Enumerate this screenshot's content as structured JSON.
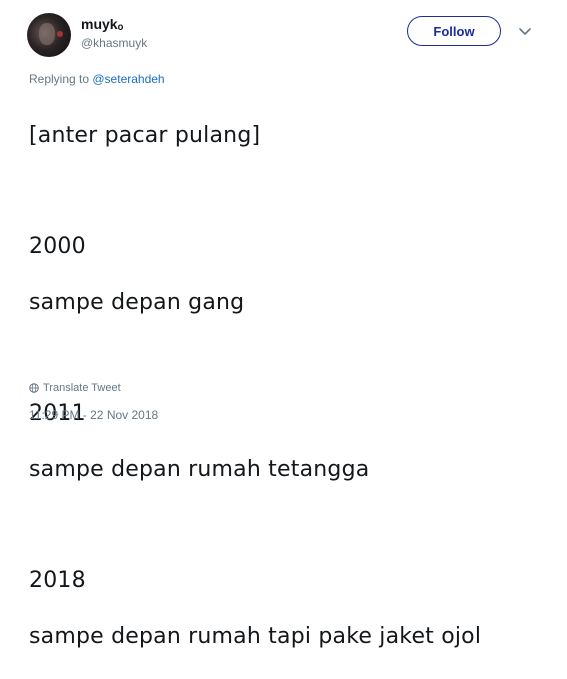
{
  "author": {
    "display_name": "muykₒ",
    "username": "@khasmuyk"
  },
  "follow_label": "Follow",
  "reply": {
    "prefix": "Replying to ",
    "mention": "@seterahdeh"
  },
  "tweet": {
    "lines": [
      "[anter pacar pulang]",
      "2000",
      "sampe depan gang",
      "2011",
      "sampe depan rumah tetangga",
      "2018",
      "sampe depan rumah tapi pake jaket ojol"
    ]
  },
  "translate_label": "Translate Tweet",
  "timestamp": "11:29 PM - 22 Nov 2018",
  "icons": {
    "menu": "chevron-down-icon",
    "translate": "globe-icon"
  },
  "colors": {
    "follow_accent": "#1b2d9a",
    "mention": "#1b6ec2",
    "muted": "#657786"
  }
}
